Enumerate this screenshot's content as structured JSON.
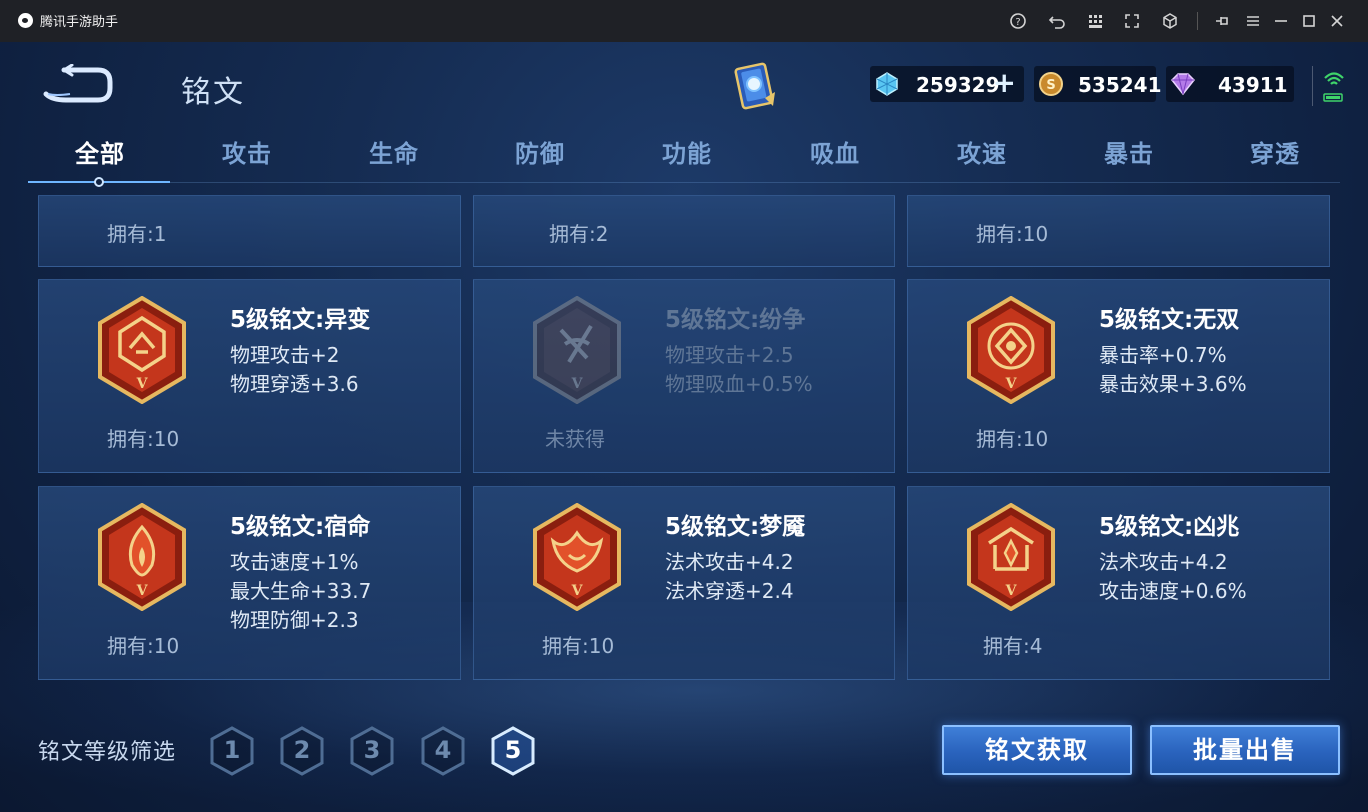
{
  "app": {
    "title": "腾讯手游助手"
  },
  "header": {
    "title": "铭文",
    "currencies": [
      {
        "icon": "diamond-coupon-icon",
        "value": "259329"
      },
      {
        "icon": "gold-coin-icon",
        "value": "535241"
      },
      {
        "icon": "gem-icon",
        "value": "43911"
      }
    ]
  },
  "tabs": [
    "全部",
    "攻击",
    "生命",
    "防御",
    "功能",
    "吸血",
    "攻速",
    "暴击",
    "穿透"
  ],
  "active_tab": "全部",
  "top_row": [
    {
      "owned": "拥有:1"
    },
    {
      "owned": "拥有:2"
    },
    {
      "owned": "拥有:10"
    }
  ],
  "runes": [
    {
      "name": "5级铭文:异变",
      "stats": [
        "物理攻击+2",
        "物理穿透+3.6"
      ],
      "owned": "拥有:10",
      "locked": false,
      "icon": "yibian-rune-icon"
    },
    {
      "name": "5级铭文:纷争",
      "stats": [
        "物理攻击+2.5",
        "物理吸血+0.5%"
      ],
      "owned": "未获得",
      "locked": true,
      "icon": "fenzheng-rune-icon"
    },
    {
      "name": "5级铭文:无双",
      "stats": [
        "暴击率+0.7%",
        "暴击效果+3.6%"
      ],
      "owned": "拥有:10",
      "locked": false,
      "icon": "wushuang-rune-icon"
    },
    {
      "name": "5级铭文:宿命",
      "stats": [
        "攻击速度+1%",
        "最大生命+33.7",
        "物理防御+2.3"
      ],
      "owned": "拥有:10",
      "locked": false,
      "icon": "suming-rune-icon"
    },
    {
      "name": "5级铭文:梦魇",
      "stats": [
        "法术攻击+4.2",
        "法术穿透+2.4"
      ],
      "owned": "拥有:10",
      "locked": false,
      "icon": "mengyan-rune-icon"
    },
    {
      "name": "5级铭文:凶兆",
      "stats": [
        "法术攻击+4.2",
        "攻击速度+0.6%"
      ],
      "owned": "拥有:4",
      "locked": false,
      "icon": "xiongzhao-rune-icon"
    }
  ],
  "footer": {
    "filter_label": "铭文等级筛选",
    "levels": [
      "1",
      "2",
      "3",
      "4",
      "5"
    ],
    "active_level": "5",
    "obtain_button": "铭文获取",
    "sell_button": "批量出售"
  },
  "colors": {
    "accent_blue": "#2a63bd",
    "rune_red": "#c4361c",
    "rune_gold": "#e6b860",
    "inactive_tab": "#7ca3d4"
  }
}
